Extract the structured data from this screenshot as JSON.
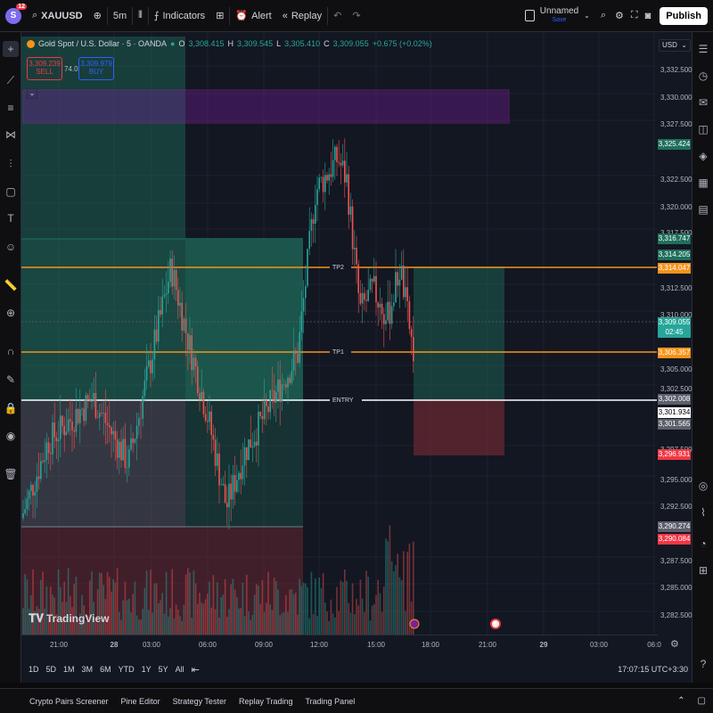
{
  "header": {
    "logo": "S",
    "notification_count": "12",
    "symbol": "XAUUSD",
    "interval": "5m",
    "indicators": "Indicators",
    "alert": "Alert",
    "replay": "Replay",
    "layout_name": "Unnamed",
    "layout_status": "Save",
    "publish": "Publish"
  },
  "legend": {
    "title": "Gold Spot / U.S. Dollar · 5 · OANDA",
    "o_label": "O",
    "o": "3,308.415",
    "h_label": "H",
    "h": "3,309.545",
    "l_label": "L",
    "l": "3,305.410",
    "c_label": "C",
    "c": "3,309.055",
    "change": "+0.675 (+0.02%)"
  },
  "trade_panel": {
    "sell_price": "3,309.239",
    "sell_label": "SELL",
    "spread": "74.0",
    "buy_price": "3,309.979",
    "buy_label": "BUY"
  },
  "currency": "USD",
  "price_ticks": [
    "3,332.500",
    "3,330.000",
    "3,327.500",
    "3,322.500",
    "3,320.000",
    "3,317.500",
    "3,312.500",
    "3,310.000",
    "3,305.000",
    "3,302.500",
    "3,297.500",
    "3,295.000",
    "3,292.500",
    "3,287.500",
    "3,285.000",
    "3,282.500"
  ],
  "price_labels": [
    {
      "text": "3,325.424",
      "color": "#1f6f5c"
    },
    {
      "text": "3,316.747",
      "color": "#1f6f5c"
    },
    {
      "text": "3,314.205",
      "color": "#1f6f5c"
    },
    {
      "text": "3,314.047",
      "color": "#f7931a"
    },
    {
      "text": "3,309.055",
      "color": "#26a69a"
    },
    {
      "text": "02:45",
      "color": "#26a69a"
    },
    {
      "text": "3,306.357",
      "color": "#f7931a"
    },
    {
      "text": "3,302.008",
      "color": "#5d606b"
    },
    {
      "text": "3,301.934",
      "color": "#ffffff"
    },
    {
      "text": "3,301.565",
      "color": "#5d606b"
    },
    {
      "text": "3,296.931",
      "color": "#f23645"
    },
    {
      "text": "3,290.274",
      "color": "#5d606b"
    },
    {
      "text": "3,290.084",
      "color": "#f23645"
    }
  ],
  "lines": {
    "tp2": "TP2",
    "tp1": "TP1",
    "entry": "ENTRY"
  },
  "time_ticks": [
    "21:00",
    "28",
    "03:00",
    "06:00",
    "09:00",
    "12:00",
    "15:00",
    "18:00",
    "21:00",
    "29",
    "03:00",
    "06:0"
  ],
  "ranges": [
    "1D",
    "5D",
    "1M",
    "3M",
    "6M",
    "YTD",
    "1Y",
    "5Y",
    "All"
  ],
  "clock": "17:07:15 UTC+3:30",
  "bottom_tabs": [
    "Crypto Pairs Screener",
    "Pine Editor",
    "Strategy Tester",
    "Replay Trading",
    "Trading Panel"
  ],
  "branding": "TradingView",
  "colors": {
    "background": "#131722",
    "up": "#26a69a",
    "down": "#ef5350",
    "tp_line": "#f7931a",
    "entry_line": "#ffffff",
    "zone_purple": "#7b1fa2"
  }
}
